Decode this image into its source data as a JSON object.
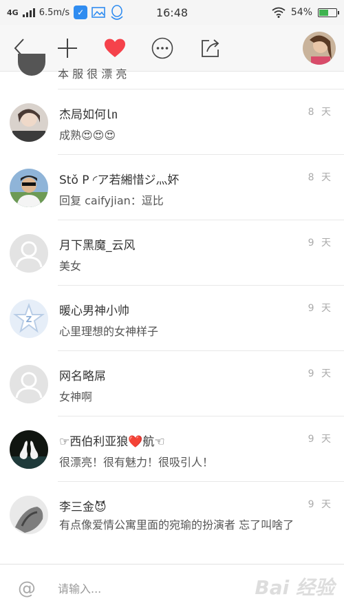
{
  "status_bar": {
    "network": "4G",
    "speed": "6.5m/s",
    "time": "16:48",
    "battery": "54%",
    "battery_level": 0.54
  },
  "toolbar": {
    "icons": [
      "back-icon",
      "add-icon",
      "heart-icon",
      "more-icon",
      "share-icon"
    ],
    "heart_color": "#f5424b"
  },
  "list": {
    "partial_item": {
      "text": "本 服 很 漂 亮"
    },
    "items": [
      {
        "name": "杰局如何㏑",
        "comment": "成熟😍😍😍",
        "time": "8 天"
      },
      {
        "name": "Stǒ P ◜ア若緗惜ジ灬妚",
        "comment": "回复 caifyjian：逗比",
        "time": "8 天"
      },
      {
        "name": "月下黑魔_云风",
        "comment": "美女",
        "time": "9 天"
      },
      {
        "name": "暖心男神小帅",
        "comment": "心里理想的女神样子",
        "time": "9 天"
      },
      {
        "name": "网名略屌",
        "comment": "女神啊",
        "time": "9 天"
      },
      {
        "name": "☞西伯利亚狼❤️航☜",
        "comment": "很漂亮！很有魅力！很吸引人！",
        "time": "9 天"
      },
      {
        "name": "李三金😈",
        "comment": "有点像爱情公寓里面的宛瑜的扮演者 忘了叫啥了",
        "time": "9 天"
      }
    ]
  },
  "input_bar": {
    "at_symbol": "@",
    "placeholder": "请输入...",
    "watermark": "Bai 经验"
  }
}
